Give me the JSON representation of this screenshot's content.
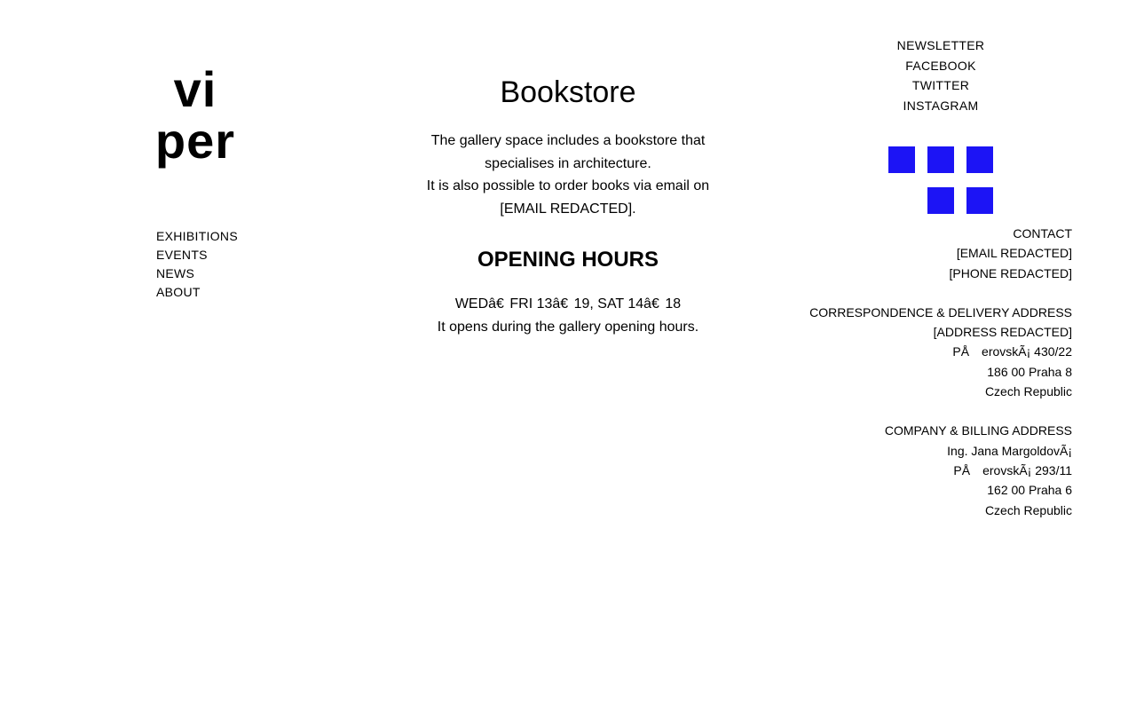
{
  "logo": {
    "line1": "vi",
    "line2": "per"
  },
  "nav": {
    "items": [
      {
        "label": "EXHIBITIONS"
      },
      {
        "label": "EVENTS"
      },
      {
        "label": "NEWS"
      },
      {
        "label": "ABOUT"
      }
    ]
  },
  "main": {
    "title": "Bookstore",
    "description": [
      "The gallery space includes a bookstore that",
      "specialises in architecture.",
      "It is also possible to order books via email on",
      "[EMAIL REDACTED]."
    ],
    "hours_heading": "OPENING HOURS",
    "hours_lines": [
      "WEDâ€  FRI 13â€  19, SAT 14â€  18",
      "It opens during the gallery opening hours."
    ]
  },
  "social": {
    "links": [
      {
        "label": "NEWSLETTER"
      },
      {
        "label": "FACEBOOK"
      },
      {
        "label": "TWITTER"
      },
      {
        "label": "INSTAGRAM"
      }
    ],
    "icon_color": "#1c14f5",
    "icons": [
      "social-icon-1",
      "social-icon-2",
      "social-icon-3",
      "social-icon-4",
      "social-icon-5"
    ]
  },
  "contact": {
    "heading": "CONTACT",
    "email": "[EMAIL REDACTED]",
    "phone": "[PHONE REDACTED]",
    "correspondence": {
      "heading": "CORRESPONDENCE & DELIVERY ADDRESS",
      "lines": [
        "[ADDRESS REDACTED]",
        "PÅ erovskÃ¡ 430/22",
        "186 00 Praha 8",
        "Czech Republic"
      ]
    },
    "billing": {
      "heading": "COMPANY & BILLING ADDRESS",
      "lines": [
        "Ing. Jana MargoldovÃ¡",
        "PÅ erovskÃ¡ 293/11",
        "162 00 Praha 6",
        "Czech Republic"
      ]
    }
  }
}
